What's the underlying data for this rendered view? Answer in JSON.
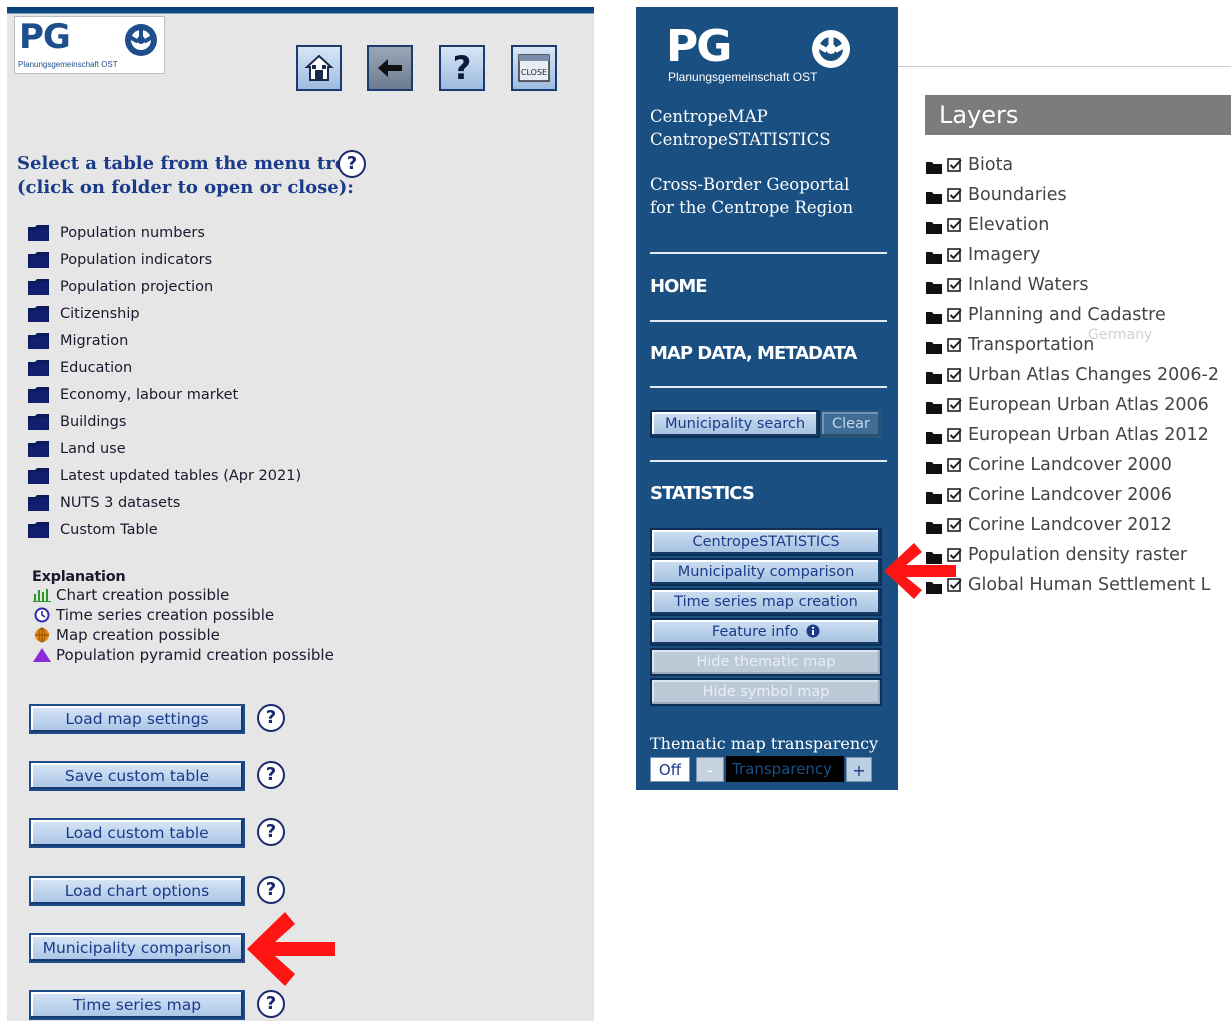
{
  "left": {
    "logo": {
      "letters": "PG",
      "subtitle": "Planungsgemeinschaft OST"
    },
    "toolbar": {
      "home_icon": "home-icon",
      "back_icon": "arrow-left-icon",
      "help_label": "?",
      "close_label": "CLOSE"
    },
    "title_line1": "Select a table from the menu tree",
    "title_line2": "(click on folder to open or close):",
    "help_label": "?",
    "tree": [
      "Population numbers",
      "Population indicators",
      "Population projection",
      "Citizenship",
      "Migration",
      "Education",
      "Economy, labour market",
      "Buildings",
      "Land use",
      "Latest updated tables (Apr 2021)",
      "NUTS 3 datasets",
      "Custom Table"
    ],
    "explanation": {
      "title": "Explanation",
      "items": [
        "Chart creation possible",
        "Time series creation possible",
        "Map creation possible",
        "Population pyramid creation possible"
      ]
    },
    "buttons": [
      "Load map settings",
      "Save custom table",
      "Load custom table",
      "Load chart options",
      "Municipality comparison",
      "Time series map"
    ]
  },
  "right": {
    "logo": {
      "letters": "PG",
      "subtitle": "Planungsgemeinschaft OST"
    },
    "app_line1": "CentropeMAP",
    "app_line2": "CentropeSTATISTICS",
    "desc_line1": "Cross-Border Geoportal",
    "desc_line2": "for the Centrope Region",
    "nav_home": "HOME",
    "nav_map_data": "MAP DATA, METADATA",
    "municipality_search": "Municipality search",
    "clear": "Clear",
    "statistics_heading": "STATISTICS",
    "stat_buttons": [
      "CentropeSTATISTICS",
      "Municipality comparison",
      "Time series map creation",
      "Feature info",
      "Hide thematic map",
      "Hide symbol map"
    ],
    "transparency_label": "Thematic map transparency",
    "transparency_off": "Off",
    "transparency_minus": "-",
    "transparency_bar": "Transparency",
    "transparency_plus": "+",
    "layers_title": "Layers",
    "layers": [
      "Biota",
      "Boundaries",
      "Elevation",
      "Imagery",
      "Inland Waters",
      "Planning and Cadastre",
      "Transportation",
      "Urban Atlas Changes 2006-2",
      "European Urban Atlas 2006",
      "European Urban Atlas 2012",
      "Corine Landcover 2000",
      "Corine Landcover 2006",
      "Corine Landcover 2012",
      "Population density raster",
      "Global Human Settlement L"
    ],
    "map_label": "Germany"
  },
  "colors": {
    "left_bg": "#e6e6e6",
    "sidebar_bg": "#1a4f82",
    "button_text": "#1a3a8a",
    "arrow": "#ff0000",
    "layers_header_bg": "#7c7c7c"
  }
}
